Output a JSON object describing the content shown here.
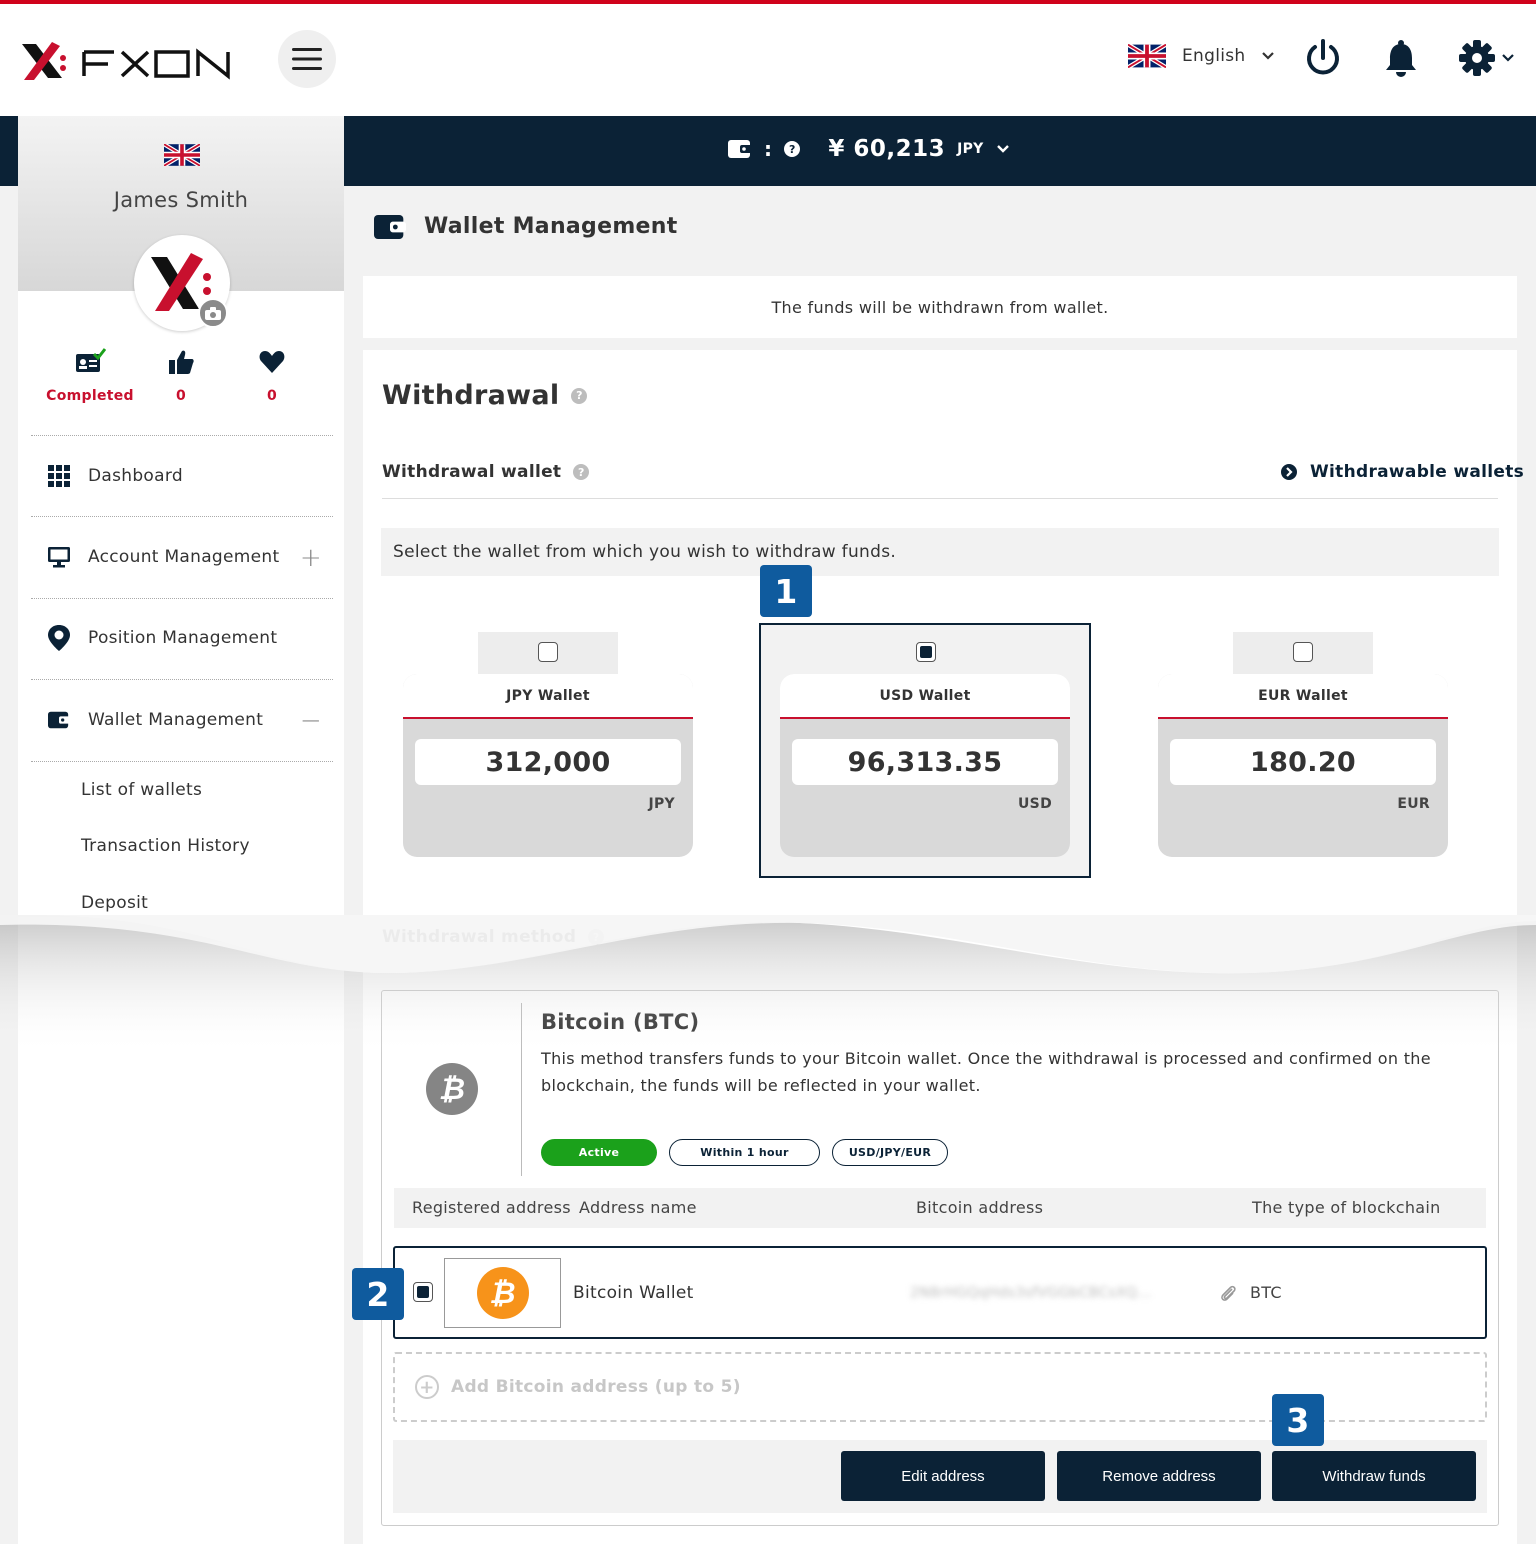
{
  "header": {
    "brand": "FXON",
    "language": "English"
  },
  "balance_bar": {
    "separator": ":",
    "amount": "¥ 60,213",
    "currency": "JPY"
  },
  "sidebar": {
    "user_name": "James Smith",
    "stats": [
      {
        "value": "Completed",
        "icon": "id-card-check-icon"
      },
      {
        "value": "0",
        "icon": "thumbs-up-icon"
      },
      {
        "value": "0",
        "icon": "heart-icon"
      }
    ],
    "nav": [
      {
        "label": "Dashboard",
        "icon": "grid-icon"
      },
      {
        "label": "Account Management",
        "icon": "monitor-icon",
        "toggle": "+"
      },
      {
        "label": "Position Management",
        "icon": "map-pin-icon"
      },
      {
        "label": "Wallet Management",
        "icon": "wallet-icon",
        "toggle": "−"
      }
    ],
    "sub_nav": [
      "List of wallets",
      "Transaction History",
      "Deposit"
    ]
  },
  "main": {
    "page_title": "Wallet Management",
    "notice": "The funds will be withdrawn from wallet.",
    "heading": "Withdrawal",
    "wallet_section_label": "Withdrawal wallet",
    "withdrawable_link": "Withdrawable wallets",
    "select_prompt": "Select the wallet from which you wish to withdraw funds.",
    "wallets": [
      {
        "name": "JPY Wallet",
        "amount": "312,000",
        "currency": "JPY",
        "selected": false
      },
      {
        "name": "USD Wallet",
        "amount": "96,313.35",
        "currency": "USD",
        "selected": true
      },
      {
        "name": "EUR Wallet",
        "amount": "180.20",
        "currency": "EUR",
        "selected": false
      }
    ],
    "method_section_label": "Withdrawal method",
    "method": {
      "title": "Bitcoin (BTC)",
      "description": "This method transfers funds to your Bitcoin wallet. Once the withdrawal is processed and confirmed on the blockchain, the funds will be reflected in your wallet.",
      "tags": [
        "Active",
        "Within 1 hour",
        "USD/JPY/EUR"
      ]
    },
    "address_table": {
      "headers": [
        "Registered address",
        "Address name",
        "Bitcoin address",
        "The type of blockchain"
      ],
      "rows": [
        {
          "name": "Bitcoin Wallet",
          "address": "2N8rHGQqHds3sfVGGbCBCsXQ...",
          "type": "BTC",
          "selected": true
        }
      ],
      "add_label": "Add Bitcoin address (up to 5)"
    },
    "buttons": {
      "edit": "Edit address",
      "remove": "Remove address",
      "withdraw": "Withdraw funds"
    }
  },
  "step_badges": [
    "1",
    "2",
    "3"
  ],
  "colors": {
    "navy": "#0b2236",
    "brand_red": "#c8102e",
    "badge_blue": "#0f5b9e",
    "active_green": "#1ba11b",
    "bitcoin_orange": "#f7931a"
  }
}
